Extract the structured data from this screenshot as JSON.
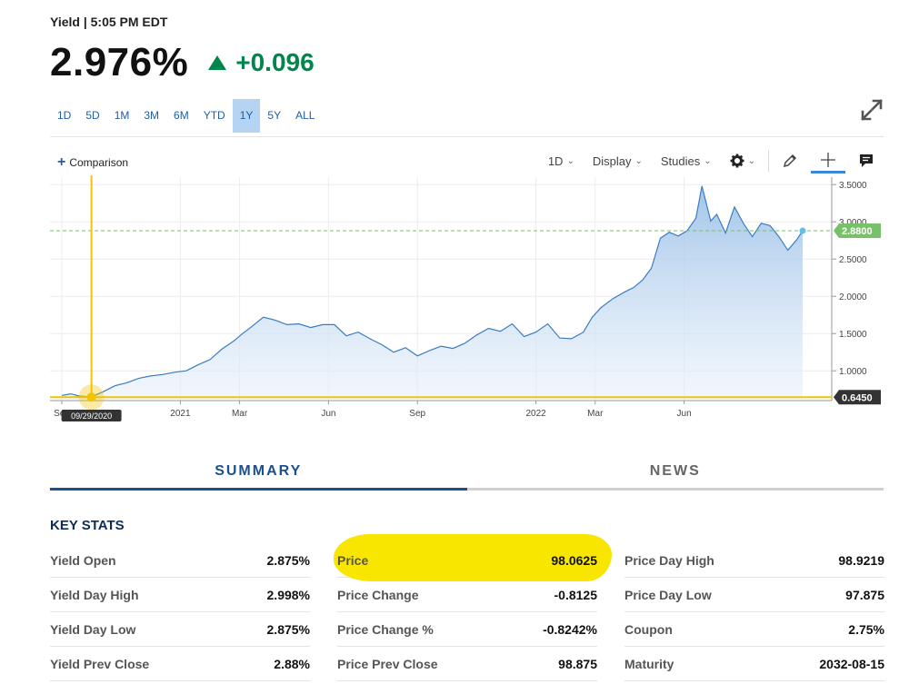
{
  "header": {
    "label": "Yield | 5:05 PM EDT",
    "value": "2.976%",
    "change": "+0.096",
    "change_direction": "up",
    "up_color": "#00864c"
  },
  "range_tabs": [
    {
      "label": "1D",
      "active": false
    },
    {
      "label": "5D",
      "active": false
    },
    {
      "label": "1M",
      "active": false
    },
    {
      "label": "3M",
      "active": false
    },
    {
      "label": "6M",
      "active": false
    },
    {
      "label": "YTD",
      "active": false
    },
    {
      "label": "1Y",
      "active": true
    },
    {
      "label": "5Y",
      "active": false
    },
    {
      "label": "ALL",
      "active": false
    }
  ],
  "toolbar": {
    "comparison": "Comparison",
    "interval": "1D",
    "display": "Display",
    "studies": "Studies",
    "icons": [
      "settings-icon",
      "draw-pencil-icon",
      "crosshair-icon",
      "comment-icon"
    ]
  },
  "chart_data": {
    "type": "area",
    "x_tick_labels": [
      "Sep",
      "2021",
      "Mar",
      "Jun",
      "Sep",
      "2022",
      "Mar",
      "Jun"
    ],
    "y_tick_labels": [
      "1.0000",
      "1.5000",
      "2.0000",
      "2.5000",
      "3.0000",
      "3.5000"
    ],
    "y_ticks": [
      1.0,
      1.5,
      2.0,
      2.5,
      3.0,
      3.5
    ],
    "ylim": [
      0.6,
      3.6
    ],
    "x_range_months": [
      0,
      25
    ],
    "current_value_label": "2.8800",
    "current_value": 2.88,
    "crosshair_value_label": "0.6450",
    "crosshair_value": 0.645,
    "crosshair_date_label": "09/29/2020",
    "crosshair_x": 1.0,
    "line_color": "#3a7cc2",
    "crosshair_color": "#f2c300",
    "current_badge_color": "#78c06a",
    "grid": true,
    "series": [
      {
        "x": [
          0.0,
          0.3,
          0.6,
          1.0,
          1.4,
          1.8,
          2.2,
          2.6,
          3.0,
          3.4,
          3.8,
          4.2,
          4.6,
          5.0,
          5.4,
          5.8,
          6.1,
          6.4,
          6.8,
          7.2,
          7.6,
          8.0,
          8.4,
          8.8,
          9.2,
          9.6,
          10.0,
          10.4,
          10.8,
          11.2,
          11.6,
          12.0,
          12.4,
          12.8,
          13.2,
          13.6,
          14.0,
          14.4,
          14.8,
          15.2,
          15.6,
          16.0,
          16.4,
          16.8,
          17.2,
          17.6,
          17.9,
          18.2,
          18.6,
          19.0,
          19.3,
          19.6,
          19.9,
          20.2,
          20.5,
          20.8,
          21.1,
          21.4,
          21.6,
          21.9,
          22.1,
          22.4,
          22.7,
          23.0,
          23.3,
          23.6,
          23.9,
          24.2,
          24.5,
          24.8,
          25.0
        ],
        "values": [
          0.67,
          0.69,
          0.66,
          0.65,
          0.72,
          0.8,
          0.84,
          0.9,
          0.93,
          0.95,
          0.98,
          1.0,
          1.08,
          1.15,
          1.29,
          1.4,
          1.5,
          1.59,
          1.72,
          1.68,
          1.62,
          1.63,
          1.58,
          1.62,
          1.62,
          1.47,
          1.52,
          1.43,
          1.35,
          1.25,
          1.31,
          1.2,
          1.27,
          1.33,
          1.3,
          1.37,
          1.48,
          1.57,
          1.53,
          1.63,
          1.46,
          1.52,
          1.63,
          1.44,
          1.43,
          1.52,
          1.72,
          1.85,
          1.97,
          2.06,
          2.12,
          2.22,
          2.38,
          2.78,
          2.86,
          2.81,
          2.88,
          3.05,
          3.48,
          3.01,
          3.1,
          2.85,
          3.2,
          2.98,
          2.8,
          2.98,
          2.95,
          2.8,
          2.62,
          2.76,
          2.88
        ]
      }
    ]
  },
  "content_tabs": [
    "SUMMARY",
    "NEWS"
  ],
  "key_stats": {
    "title": "KEY STATS",
    "highlight_color": "#f8e600",
    "columns": [
      [
        {
          "label": "Yield Open",
          "value": "2.875%"
        },
        {
          "label": "Yield Day High",
          "value": "2.998%"
        },
        {
          "label": "Yield Day Low",
          "value": "2.875%"
        },
        {
          "label": "Yield Prev Close",
          "value": "2.88%"
        }
      ],
      [
        {
          "label": "Price",
          "value": "98.0625",
          "highlighted": true
        },
        {
          "label": "Price Change",
          "value": "-0.8125"
        },
        {
          "label": "Price Change %",
          "value": "-0.8242%"
        },
        {
          "label": "Price Prev Close",
          "value": "98.875"
        }
      ],
      [
        {
          "label": "Price Day High",
          "value": "98.9219"
        },
        {
          "label": "Price Day Low",
          "value": "97.875"
        },
        {
          "label": "Coupon",
          "value": "2.75%"
        },
        {
          "label": "Maturity",
          "value": "2032-08-15"
        }
      ]
    ]
  }
}
